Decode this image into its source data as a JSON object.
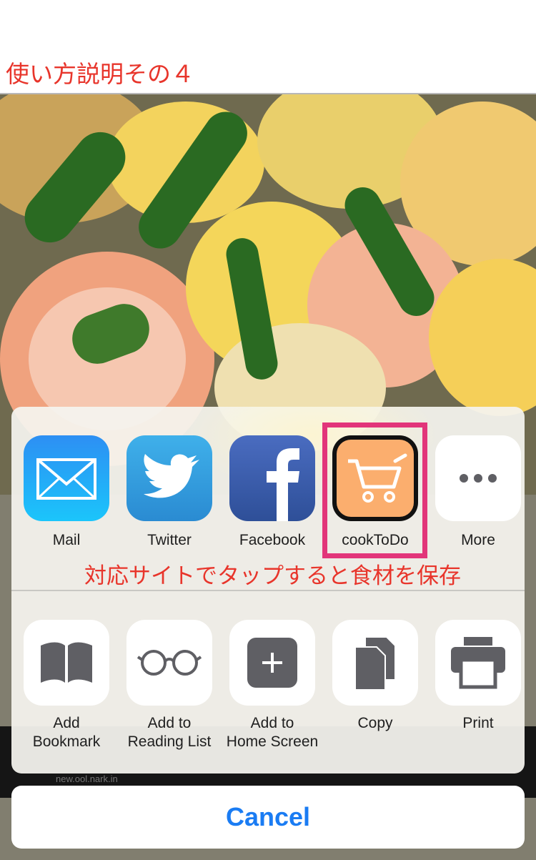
{
  "page": {
    "title": "使い方説明その４"
  },
  "share_sheet": {
    "apps": [
      {
        "label": "Mail",
        "icon": "mail-icon"
      },
      {
        "label": "Twitter",
        "icon": "twitter-bird-icon"
      },
      {
        "label": "Facebook",
        "icon": "facebook-f-icon"
      },
      {
        "label": "cookToDo",
        "icon": "shopping-cart-icon"
      },
      {
        "label": "More",
        "icon": "more-dots-icon"
      }
    ],
    "annotation": "対応サイトでタップすると食材を保存",
    "actions": [
      {
        "line1": "Add",
        "line2": "Bookmark",
        "icon": "book-icon"
      },
      {
        "line1": "Add to",
        "line2": "Reading List",
        "icon": "glasses-icon"
      },
      {
        "line1": "Add to",
        "line2": "Home Screen",
        "icon": "plus-square-icon"
      },
      {
        "line1": "Copy",
        "line2": "",
        "icon": "copy-icon"
      },
      {
        "line1": "Print",
        "line2": "",
        "icon": "printer-icon"
      }
    ],
    "cancel_label": "Cancel"
  },
  "background": {
    "faint_text": "new.ool.nark.in"
  },
  "colors": {
    "annotation_red": "#e8352b",
    "highlight_pink": "#e2357a",
    "cancel_blue": "#1a7cf3",
    "cooktodo_orange": "#fbae6e"
  }
}
